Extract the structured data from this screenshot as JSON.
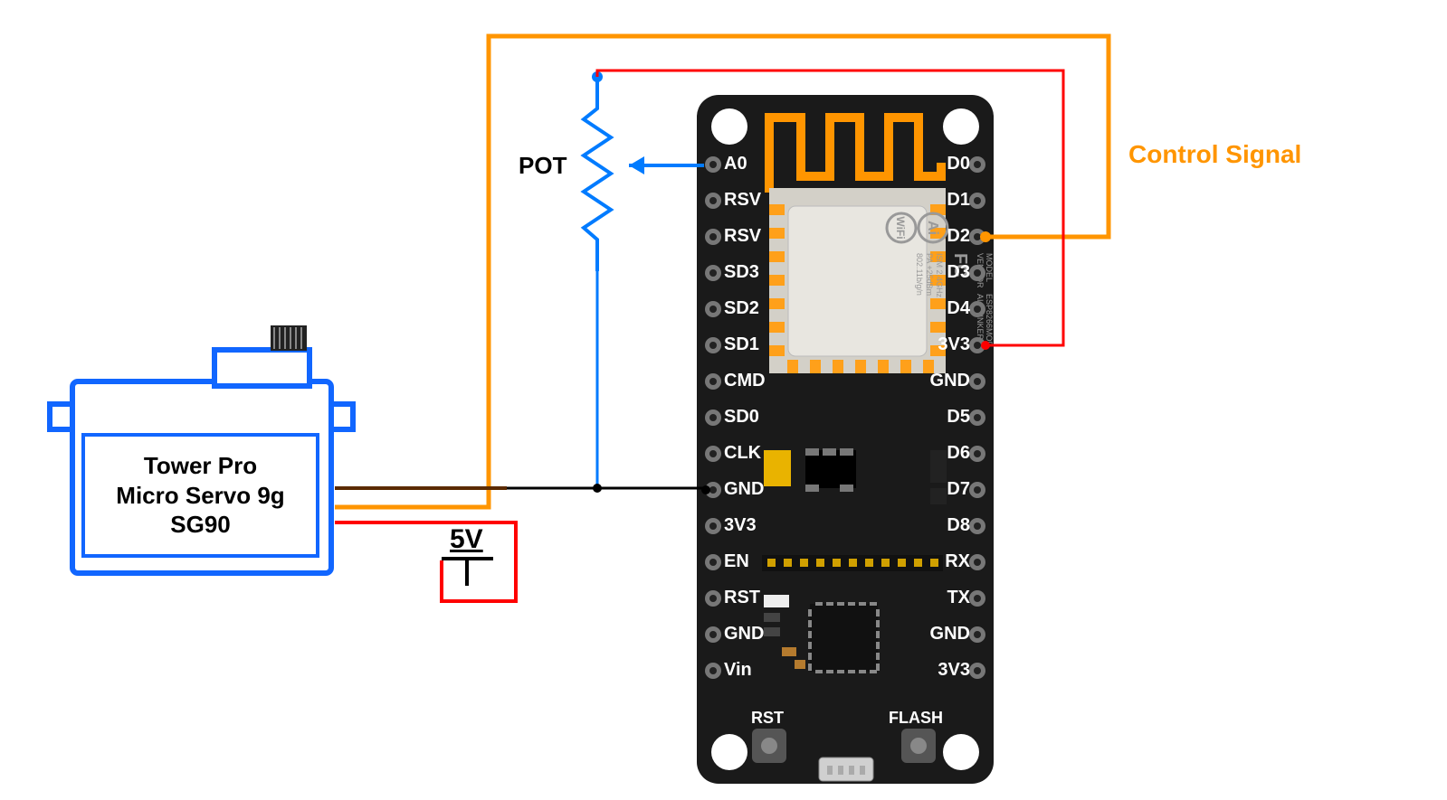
{
  "servo": {
    "brand": "Tower Pro",
    "model_line": "Micro Servo 9g",
    "part_number": "SG90"
  },
  "labels": {
    "pot": "POT",
    "five_volt": "5V",
    "control_signal": "Control Signal",
    "rst_button": "RST",
    "flash_button": "FLASH"
  },
  "board": {
    "pins_left": [
      "A0",
      "RSV",
      "RSV",
      "SD3",
      "SD2",
      "SD1",
      "CMD",
      "SD0",
      "CLK",
      "GND",
      "3V3",
      "EN",
      "RST",
      "GND",
      "Vin"
    ],
    "pins_right": [
      "D0",
      "D1",
      "D2",
      "D3",
      "D4",
      "3V3",
      "GND",
      "D5",
      "D6",
      "D7",
      "D8",
      "RX",
      "TX",
      "GND",
      "3V3"
    ],
    "esp_module": {
      "model": "ESP8266MOD",
      "vendor": "AI-THINKER",
      "ism": "ISM 2.4GHz",
      "pa": "PA +25dBm",
      "proto": "802.11b/g/n",
      "fcc": "FC",
      "brand1": "Ai",
      "brand2": "WiFi",
      "label_model": "MODEL",
      "label_vendor": "VENDOR"
    }
  },
  "wiring": {
    "signal_wire": "D2 → Servo control (orange)",
    "power_3v3": "3V3 → POT top (red)",
    "pot_wiper": "POT wiper → A0 (blue)",
    "pot_bottom": "POT bottom → GND rail (blue)",
    "servo_gnd": "Servo GND → NodeMCU GND (black/brown)",
    "servo_vcc": "Servo VCC → external 5V (red)"
  }
}
